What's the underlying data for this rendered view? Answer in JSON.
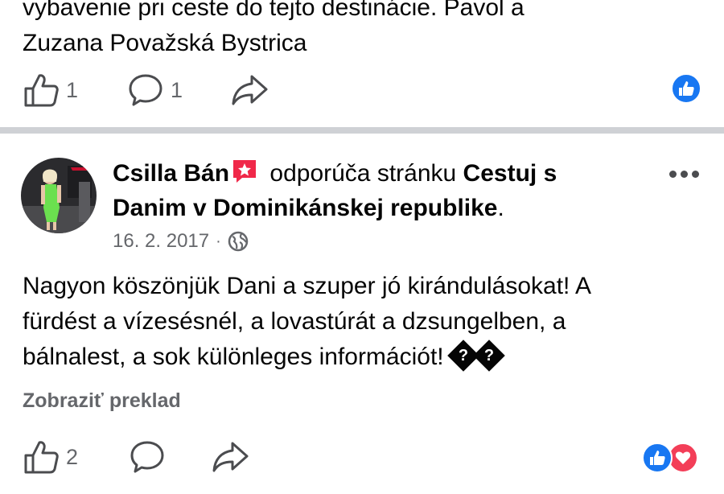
{
  "previous_post": {
    "text_line1": "vybavenie pri ceste do tejto destinácie. Pavol a",
    "text_line2": "Zuzana Považská Bystrica",
    "like_count": "1",
    "comment_count": "1"
  },
  "post": {
    "author": "Csilla Bán",
    "recommends_text": " odporúča stránku ",
    "page_name": "Cestuj s Danim v Dominikánskej republike",
    "page_name_line1": "Cestuj s",
    "page_name_line2": "Danim v Dominikánskej republike",
    "period": ".",
    "date": "16. 2. 2017",
    "separator": "·",
    "body_line1": "Nagyon köszönjük Dani a szuper jó kirándulásokat! A",
    "body_line2": "fürdést a vízesésnél, a lovastúrát a dzsungelben, a",
    "body_line3": "bálnalest, a sok különleges információt!",
    "unknown_glyph": "?",
    "translate_label": "Zobraziť preklad",
    "like_count": "2"
  },
  "colors": {
    "facebook_blue": "#1877f2",
    "love_red": "#f33e58",
    "recommend_red": "#f02849",
    "secondary_text": "#65676b",
    "divider": "#cfd1d5"
  },
  "icons": {
    "like": "thumbs-up-outline-icon",
    "comment": "comment-bubble-icon",
    "share": "share-arrow-icon",
    "globe": "globe-icon",
    "recommend": "recommend-star-icon",
    "more": "more-options-icon",
    "like_reaction": "like-reaction-icon",
    "love_reaction": "love-reaction-icon"
  }
}
